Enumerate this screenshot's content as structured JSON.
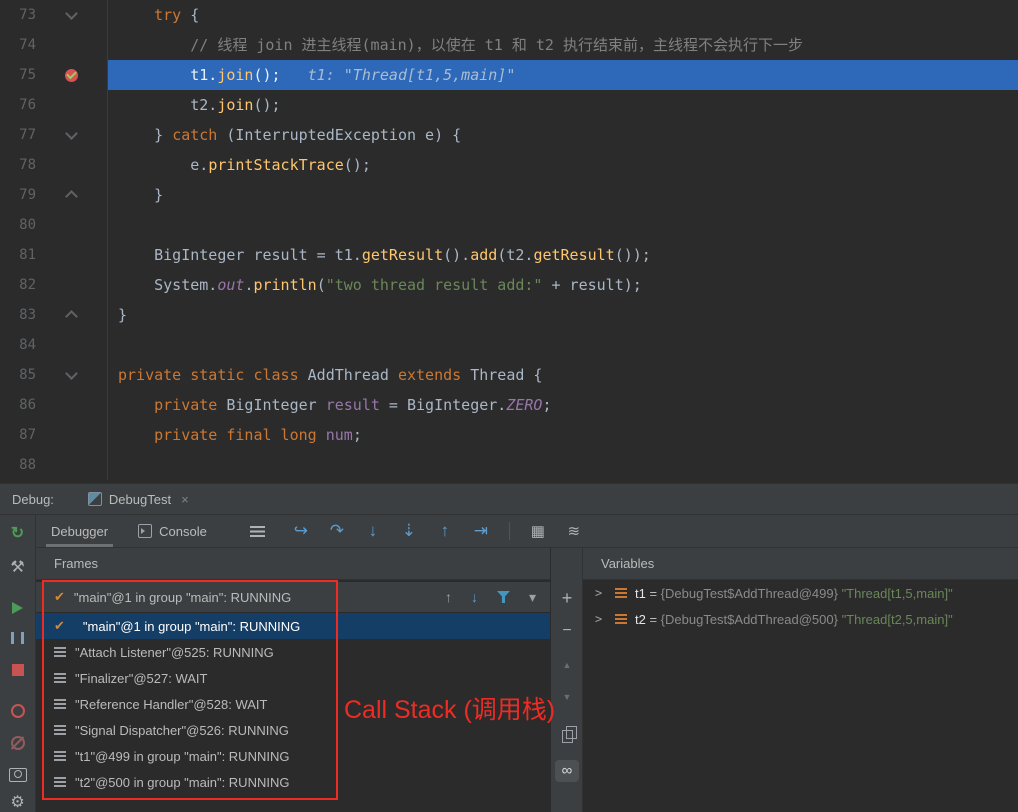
{
  "editor": {
    "lines": [
      {
        "num": "73",
        "fold": "down",
        "tokens": [
          [
            "pl",
            "    "
          ],
          [
            "kw",
            "try"
          ],
          [
            "pl",
            " {"
          ]
        ]
      },
      {
        "num": "74",
        "tokens": [
          [
            "cm",
            "        // 线程 join 进主线程(main)，以使在 t1 和 t2 执行结束前，主线程不会执行下一步"
          ]
        ]
      },
      {
        "num": "75",
        "breakpoint": true,
        "current": true,
        "tokens": [
          [
            "pl",
            "        t1."
          ],
          [
            "mth",
            "join"
          ],
          [
            "pl",
            "();"
          ],
          [
            "hint",
            "   t1: \"Thread[t1,5,main]\""
          ]
        ]
      },
      {
        "num": "76",
        "tokens": [
          [
            "pl",
            "        t2."
          ],
          [
            "mth",
            "join"
          ],
          [
            "pl",
            "();"
          ]
        ]
      },
      {
        "num": "77",
        "fold": "down",
        "tokens": [
          [
            "pl",
            "    } "
          ],
          [
            "kw",
            "catch"
          ],
          [
            "pl",
            " (InterruptedException e) {"
          ]
        ]
      },
      {
        "num": "78",
        "tokens": [
          [
            "pl",
            "        e."
          ],
          [
            "mth",
            "printStackTrace"
          ],
          [
            "pl",
            "();"
          ]
        ]
      },
      {
        "num": "79",
        "fold": "up",
        "tokens": [
          [
            "pl",
            "    }"
          ]
        ]
      },
      {
        "num": "80",
        "tokens": []
      },
      {
        "num": "81",
        "tokens": [
          [
            "pl",
            "    BigInteger result = t1."
          ],
          [
            "mth",
            "getResult"
          ],
          [
            "pl",
            "()."
          ],
          [
            "mth",
            "add"
          ],
          [
            "pl",
            "(t2."
          ],
          [
            "mth",
            "getResult"
          ],
          [
            "pl",
            "());"
          ]
        ]
      },
      {
        "num": "82",
        "tokens": [
          [
            "pl",
            "    System."
          ],
          [
            "sfld",
            "out"
          ],
          [
            "pl",
            "."
          ],
          [
            "mth",
            "println"
          ],
          [
            "pl",
            "("
          ],
          [
            "str",
            "\"two thread result add:\""
          ],
          [
            "pl",
            " + result);"
          ]
        ]
      },
      {
        "num": "83",
        "fold": "up",
        "tokens": [
          [
            "pl",
            "}"
          ]
        ]
      },
      {
        "num": "84",
        "tokens": []
      },
      {
        "num": "85",
        "fold": "down",
        "tokens": [
          [
            "kw",
            "private static class"
          ],
          [
            "pl",
            " AddThread "
          ],
          [
            "kw",
            "extends"
          ],
          [
            "pl",
            " Thread {"
          ]
        ]
      },
      {
        "num": "86",
        "tokens": [
          [
            "pl",
            "    "
          ],
          [
            "kw",
            "private"
          ],
          [
            "pl",
            " BigInteger "
          ],
          [
            "fld",
            "result"
          ],
          [
            "pl",
            " = BigInteger."
          ],
          [
            "sfld",
            "ZERO"
          ],
          [
            "pl",
            ";"
          ]
        ]
      },
      {
        "num": "87",
        "tokens": [
          [
            "pl",
            "    "
          ],
          [
            "kw",
            "private final long"
          ],
          [
            "pl",
            " "
          ],
          [
            "fld",
            "num"
          ],
          [
            "pl",
            ";"
          ]
        ]
      },
      {
        "num": "88",
        "tokens": []
      }
    ]
  },
  "debug_bar": {
    "label": "Debug:",
    "tab_label": "DebugTest",
    "close_glyph": "×"
  },
  "toolbar": {
    "debugger_tab": "Debugger",
    "console_tab": "Console"
  },
  "icons": {
    "rerun": "↻",
    "wrench": "⚒",
    "gear": "⚙",
    "show_execution_point": "↪",
    "step_over": "↷",
    "step_into": "↓",
    "force_step_into": "⇣",
    "step_out": "↑",
    "run_to_cursor": "⇥",
    "view_breakpoints_grid": "▦",
    "layout_settings": "≋",
    "plus": "+",
    "minus": "−",
    "scroll_up": "▲",
    "scroll_down": "▼",
    "infinity": "∞",
    "check": "✔",
    "chevron_right": ">",
    "arrow_up": "↑",
    "arrow_down": "↓",
    "caret_down": "▾"
  },
  "frames": {
    "header": "Frames",
    "selector_label": "\"main\"@1 in group \"main\": RUNNING",
    "threads": [
      {
        "icon": "check",
        "selected": true,
        "label": "\"main\"@1 in group \"main\": RUNNING"
      },
      {
        "icon": "thread",
        "label": "\"Attach Listener\"@525: RUNNING"
      },
      {
        "icon": "thread",
        "label": "\"Finalizer\"@527: WAIT"
      },
      {
        "icon": "thread",
        "label": "\"Reference Handler\"@528: WAIT"
      },
      {
        "icon": "thread",
        "label": "\"Signal Dispatcher\"@526: RUNNING"
      },
      {
        "icon": "thread",
        "label": "\"t1\"@499 in group \"main\": RUNNING"
      },
      {
        "icon": "thread",
        "label": "\"t2\"@500 in group \"main\": RUNNING"
      }
    ]
  },
  "variables": {
    "header": "Variables",
    "items": [
      {
        "name": "t1",
        "eq": " = ",
        "type": "{DebugTest$AddThread@499}",
        "value": " \"Thread[t1,5,main]\""
      },
      {
        "name": "t2",
        "eq": " = ",
        "type": "{DebugTest$AddThread@500}",
        "value": " \"Thread[t2,5,main]\""
      }
    ]
  },
  "annotation": {
    "text": "Call Stack (调用栈)",
    "color": "#EE2C24"
  },
  "colors": {
    "keyword": "#CC7832",
    "string": "#6A8759",
    "comment": "#808080",
    "method": "#FFC66D",
    "field": "#9876AA",
    "exec_line": "#2E68B8",
    "selection": "#153E66",
    "panel_bg": "#3C3F41",
    "editor_bg": "#2B2B2B",
    "accent_red": "#EE2C24"
  }
}
